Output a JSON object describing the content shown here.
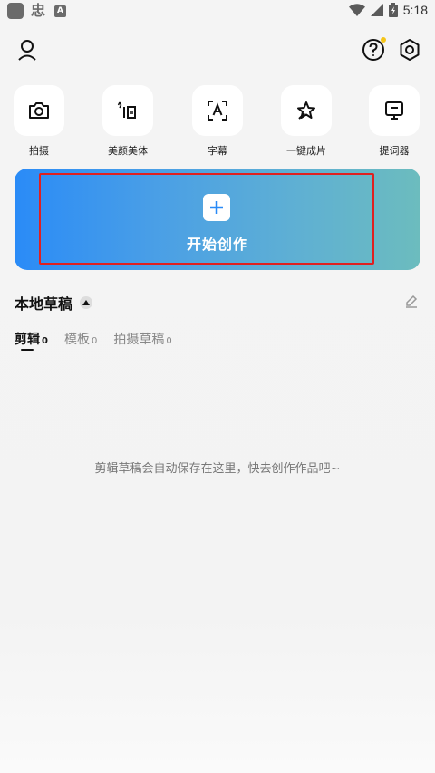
{
  "status_bar": {
    "time": "5:18",
    "left_icons": [
      "app-square-icon",
      "chinese-glyph-icon",
      "a-icon"
    ],
    "right_icons": [
      "wifi-icon",
      "signal-icon",
      "battery-icon"
    ],
    "glyph": "忠",
    "a_label": "A"
  },
  "top_bar": {
    "icons": [
      "user-icon",
      "help-icon",
      "settings-icon"
    ],
    "notification_dot_color": "#f5c518"
  },
  "tools": [
    {
      "label": "拍摄",
      "icon": "camera-icon"
    },
    {
      "label": "美颜美体",
      "icon": "beauty-icon"
    },
    {
      "label": "字幕",
      "icon": "subtitle-icon"
    },
    {
      "label": "一键成片",
      "icon": "magic-icon"
    },
    {
      "label": "提词器",
      "icon": "teleprompter-icon"
    }
  ],
  "create": {
    "label": "开始创作",
    "plus": "+",
    "gradient": [
      "#2a8bf7",
      "#6cbcbe"
    ],
    "highlight_color": "#e02020"
  },
  "drafts": {
    "title": "本地草稿",
    "tabs": [
      {
        "label": "剪辑",
        "count": "0",
        "active": true
      },
      {
        "label": "模板",
        "count": "0",
        "active": false
      },
      {
        "label": "拍摄草稿",
        "count": "0",
        "active": false
      }
    ],
    "empty_message": "剪辑草稿会自动保存在这里，快去创作作品吧~"
  }
}
